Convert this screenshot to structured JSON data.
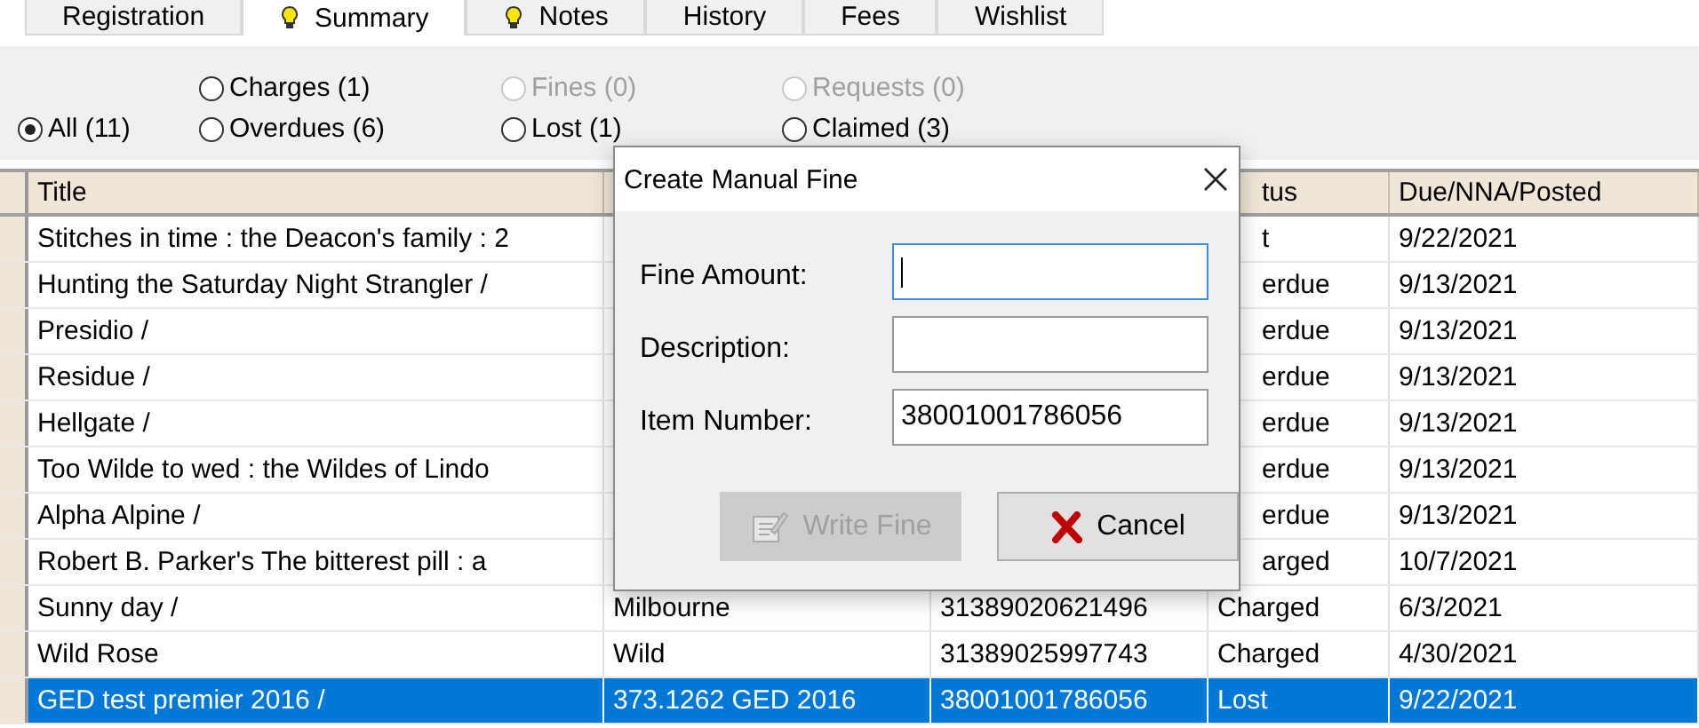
{
  "tabs": [
    {
      "label": "Registration",
      "selected": false,
      "marked": false
    },
    {
      "label": "Summary",
      "selected": true,
      "marked": true
    },
    {
      "label": "Notes",
      "selected": false,
      "marked": true
    },
    {
      "label": "History",
      "selected": false,
      "marked": false
    },
    {
      "label": "Fees",
      "selected": false,
      "marked": false
    },
    {
      "label": "Wishlist",
      "selected": false,
      "marked": false
    }
  ],
  "filters": [
    [
      {
        "label": "All (11)",
        "selected": true,
        "disabled": false
      }
    ],
    [
      {
        "label": "Charges (1)",
        "selected": false,
        "disabled": false
      },
      {
        "label": "Overdues (6)",
        "selected": false,
        "disabled": false
      }
    ],
    [
      {
        "label": "Fines (0)",
        "selected": false,
        "disabled": true
      },
      {
        "label": "Lost (1)",
        "selected": false,
        "disabled": false
      }
    ],
    [
      {
        "label": "Requests (0)",
        "selected": false,
        "disabled": true
      },
      {
        "label": "Claimed (3)",
        "selected": false,
        "disabled": false
      }
    ]
  ],
  "table": {
    "columns": [
      "Title",
      "",
      "",
      "tus",
      "Due/NNA/Posted"
    ],
    "rows": [
      {
        "cells": [
          "Stitches in time : the Deacon's family : 2",
          "",
          "",
          "t",
          "9/22/2021"
        ],
        "covered": true,
        "selected": false
      },
      {
        "cells": [
          "Hunting the Saturday Night Strangler /",
          "",
          "",
          "erdue",
          "9/13/2021"
        ],
        "covered": true,
        "selected": false
      },
      {
        "cells": [
          "Presidio /",
          "",
          "",
          "erdue",
          "9/13/2021"
        ],
        "covered": true,
        "selected": false
      },
      {
        "cells": [
          "Residue /",
          "",
          "",
          "erdue",
          "9/13/2021"
        ],
        "covered": true,
        "selected": false
      },
      {
        "cells": [
          "Hellgate /",
          "",
          "",
          "erdue",
          "9/13/2021"
        ],
        "covered": true,
        "selected": false
      },
      {
        "cells": [
          "Too Wilde to wed : the Wildes of Lindo",
          "",
          "",
          "erdue",
          "9/13/2021"
        ],
        "covered": true,
        "selected": false
      },
      {
        "cells": [
          "Alpha Alpine /",
          "",
          "",
          "erdue",
          "9/13/2021"
        ],
        "covered": true,
        "selected": false
      },
      {
        "cells": [
          "Robert B. Parker's The bitterest pill : a",
          "",
          "",
          "arged",
          "10/7/2021"
        ],
        "covered": true,
        "selected": false
      },
      {
        "cells": [
          "Sunny day /",
          "Milbourne",
          "31389020621496",
          "Charged",
          "6/3/2021"
        ],
        "covered": false,
        "selected": false
      },
      {
        "cells": [
          "Wild Rose",
          "Wild",
          "31389025997743",
          "Charged",
          "4/30/2021"
        ],
        "covered": false,
        "selected": false
      },
      {
        "cells": [
          "GED test premier 2016 /",
          "373.1262 GED 2016",
          "38001001786056",
          "Lost",
          "9/22/2021"
        ],
        "covered": false,
        "selected": true
      }
    ]
  },
  "dialog": {
    "title": "Create Manual Fine",
    "fields": [
      {
        "label": "Fine Amount:",
        "focused": true
      },
      {
        "label": "Description:",
        "focused": false
      },
      {
        "label": "Item Number:",
        "value": "38001001786056",
        "focused": false
      }
    ],
    "buttons": [
      {
        "label": "Write Fine",
        "kind": "write",
        "disabled": true
      },
      {
        "label": "Cancel",
        "kind": "cancel",
        "disabled": false
      }
    ]
  }
}
